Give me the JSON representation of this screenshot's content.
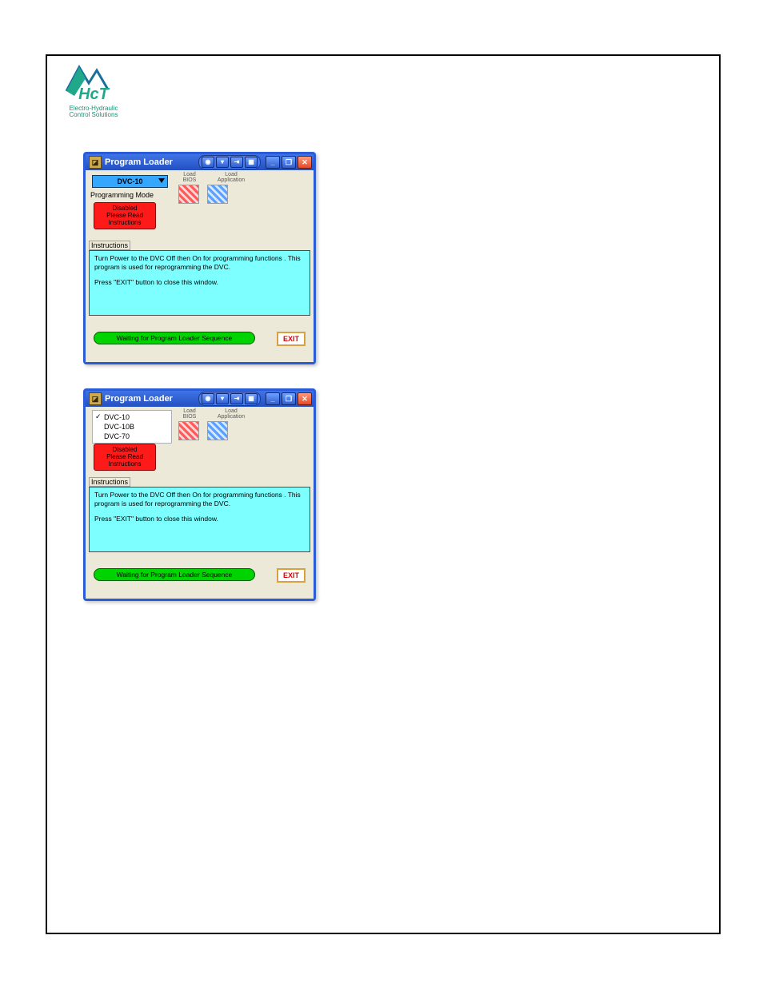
{
  "logo": {
    "brand": "HCT",
    "line1": "Electro-Hydraulic",
    "line2": "Control Solutions"
  },
  "window": {
    "title": "Program Loader",
    "toolbar_icons": [
      "eye",
      "down",
      "export",
      "grid"
    ],
    "min_label": "_",
    "restore_label": "❐",
    "close_label": "✕"
  },
  "dropdown": {
    "selected": "DVC-10",
    "options": [
      "DVC-10",
      "DVC-10B",
      "DVC-70"
    ]
  },
  "labels": {
    "programming_mode": "Programming Mode",
    "instructions": "Instructions"
  },
  "redbox": {
    "line1": "Disabled",
    "line2": "Please Read",
    "line3": "Instructions"
  },
  "load": {
    "bios": "Load\nBIOS",
    "application": "Load\nApplication"
  },
  "instructions_text": {
    "p1": "Turn Power to the DVC Off then On  for programming functions . This program is used for reprogramming the DVC.",
    "p2": "Press \"EXIT\"  button to close this window."
  },
  "status": "Waiting for Program Loader Sequence",
  "exit": "EXIT"
}
